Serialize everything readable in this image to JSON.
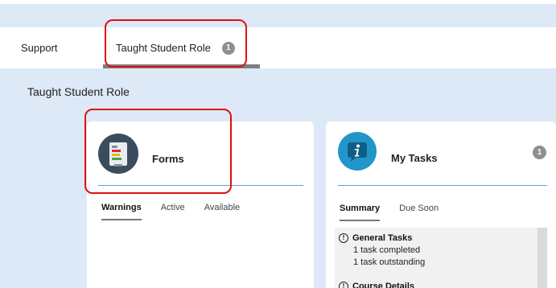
{
  "top_caption": "...",
  "tabs": [
    {
      "label": "Support"
    },
    {
      "label": "Taught Student Role",
      "badge": "1",
      "active": true
    }
  ],
  "section": {
    "title": "Taught Student Role"
  },
  "forms_card": {
    "title": "Forms",
    "icon": "forms-icon",
    "subtabs": [
      {
        "label": "Warnings",
        "active": true
      },
      {
        "label": "Active"
      },
      {
        "label": "Available"
      }
    ]
  },
  "tasks_card": {
    "title": "My Tasks",
    "icon": "info-icon",
    "count": "1",
    "subtabs": [
      {
        "label": "Summary",
        "active": true
      },
      {
        "label": "Due Soon"
      }
    ],
    "groups": [
      {
        "icon": "!",
        "title": "General Tasks",
        "lines": [
          "1 task completed",
          "1 task outstanding"
        ]
      }
    ],
    "partial_next": "Course Details"
  },
  "colors": {
    "background": "#dde9f6",
    "highlight": "#e01010",
    "accent_line": "#5aa7d8",
    "forms_icon_bg": "#3a4d5e",
    "tasks_icon_bg": "#2196c9",
    "badge": "#8f8f8f"
  }
}
